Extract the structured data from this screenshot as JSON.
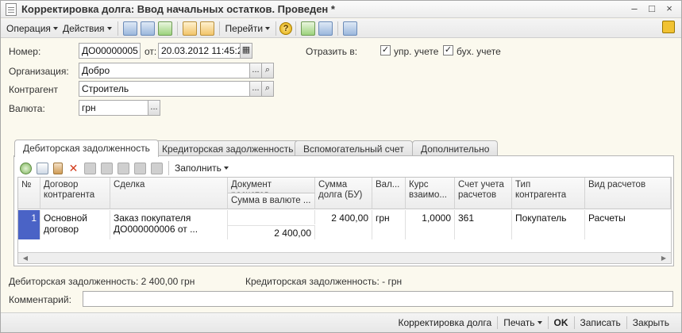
{
  "window": {
    "title": "Корректировка долга: Ввод начальных остатков. Проведен *",
    "min": "–",
    "max": "□",
    "close": "×"
  },
  "toolbar": {
    "operation": "Операция",
    "actions": "Действия",
    "goto": "Перейти",
    "help": "?"
  },
  "form": {
    "number_label": "Номер:",
    "number_value": "ДО00000005",
    "from_label": "от:",
    "date_value": "20.03.2012 11:45:26",
    "reflect_label": "Отразить в:",
    "mgmt_label": "упр. учете",
    "acct_label": "бух. учете",
    "mgmt_checked": "✓",
    "acct_checked": "✓",
    "org_label": "Организация:",
    "org_value": "Добро",
    "contractor_label": "Контрагент",
    "contractor_value": "Строитель",
    "currency_label": "Валюта:",
    "currency_value": "грн",
    "ellipsis": "...",
    "search": "🔍"
  },
  "tabs": [
    {
      "label": "Дебиторская задолженность"
    },
    {
      "label": "Кредиторская задолженность"
    },
    {
      "label": "Вспомогательный счет"
    },
    {
      "label": "Дополнительно"
    }
  ],
  "table_toolbar": {
    "fill": "Заполнить"
  },
  "table": {
    "headers": {
      "n": "№",
      "contract": "Договор контрагента",
      "deal": "Сделка",
      "settlement_doc": "Документ расчетов",
      "sum_currency": "Сумма в валюте ...",
      "debt_sum": "Сумма долга (БУ)",
      "currency": "Вал...",
      "rate": "Курс взаимо...",
      "account": "Счет учета расчетов",
      "contractor_type": "Тип контрагента",
      "settlement_kind": "Вид расчетов"
    },
    "rows": [
      {
        "n": "1",
        "contract": "Основной договор",
        "deal": "Заказ покупателя ДО000000006 от ...",
        "settlement_doc": "",
        "sum_currency": "2 400,00",
        "debt_sum": "2 400,00",
        "currency": "грн",
        "rate": "1,0000",
        "account": "361",
        "contractor_type": "Покупатель",
        "settlement_kind": "Расчеты"
      }
    ]
  },
  "totals": {
    "receivable": "Дебиторская задолженность: 2 400,00 грн",
    "payable": "Кредиторская задолженность: - грн"
  },
  "comment_label": "Комментарий:",
  "comment_value": "",
  "bottom": {
    "adjust": "Корректировка долга",
    "print": "Печать",
    "ok": "OK",
    "save": "Записать",
    "close": "Закрыть"
  }
}
